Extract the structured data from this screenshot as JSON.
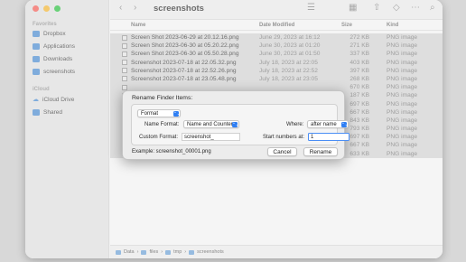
{
  "window": {
    "title": "screenshots",
    "colors": {
      "close": "#ff5f57",
      "minimize": "#febc2e",
      "zoom": "#28c840",
      "folder": "#4a90d9"
    }
  },
  "toolbar": {
    "back_icon": "‹",
    "forward_icon": "›",
    "view_icon": "☰",
    "group_icon": "▦",
    "share_icon": "⇧",
    "tag_icon": "◇",
    "more_icon": "⋯",
    "search_icon": "⌕"
  },
  "sidebar": {
    "favorites_header": "Favorites",
    "favorites": [
      "Dropbox",
      "Applications",
      "Downloads",
      "screenshots"
    ],
    "icloud_header": "iCloud",
    "icloud": [
      "iCloud Drive",
      "Shared"
    ]
  },
  "columns": {
    "name": "Name",
    "date": "Date Modified",
    "size": "Size",
    "kind": "Kind"
  },
  "files": [
    {
      "name": "Screen Shot 2023-06-29 at 20.12.16.png",
      "date": "June 29, 2023 at 16:12",
      "size": "272 KB",
      "kind": "PNG image"
    },
    {
      "name": "Screen Shot 2023-06-30 at 05.20.22.png",
      "date": "June 30, 2023 at 01:20",
      "size": "271 KB",
      "kind": "PNG image"
    },
    {
      "name": "Screen Shot 2023-06-30 at 05.50.28.png",
      "date": "June 30, 2023 at 01:50",
      "size": "337 KB",
      "kind": "PNG image"
    },
    {
      "name": "Screenshot 2023-07-18 at 22.05.32.png",
      "date": "July 18, 2023 at 22:05",
      "size": "403 KB",
      "kind": "PNG image"
    },
    {
      "name": "Screenshot 2023-07-18 at 22.52.26.png",
      "date": "July 18, 2023 at 22:52",
      "size": "397 KB",
      "kind": "PNG image"
    },
    {
      "name": "Screenshot 2023-07-18 at 23.05.48.png",
      "date": "July 18, 2023 at 23:05",
      "size": "268 KB",
      "kind": "PNG image"
    },
    {
      "name": "",
      "date": "",
      "size": "670 KB",
      "kind": "PNG image"
    },
    {
      "name": "",
      "date": "",
      "size": "187 KB",
      "kind": "PNG image"
    },
    {
      "name": "",
      "date": "",
      "size": "697 KB",
      "kind": "PNG image"
    },
    {
      "name": "",
      "date": "",
      "size": "667 KB",
      "kind": "PNG image"
    },
    {
      "name": "",
      "date": "",
      "size": "843 KB",
      "kind": "PNG image"
    },
    {
      "name": "",
      "date": "",
      "size": "793 KB",
      "kind": "PNG image"
    },
    {
      "name": "",
      "date": "",
      "size": "697 KB",
      "kind": "PNG image"
    },
    {
      "name": "",
      "date": "",
      "size": "667 KB",
      "kind": "PNG image"
    },
    {
      "name": "Screenshot 2023-07-27 at 18.06.52.png",
      "date": "July 27, 2023 at 18:06",
      "size": "633 KB",
      "kind": "PNG image"
    }
  ],
  "pathbar": [
    "Data",
    "files",
    "tmp",
    "screenshots"
  ],
  "dialog": {
    "title": "Rename Finder Items:",
    "mode": "Format",
    "name_format_label": "Name Format:",
    "name_format_value": "Name and Counter",
    "where_label": "Where:",
    "where_value": "after name",
    "custom_format_label": "Custom Format:",
    "custom_format_value": "screenshot_",
    "start_label": "Start numbers at:",
    "start_value": "1",
    "example": "Example: screenshot_00001.png",
    "cancel": "Cancel",
    "rename": "Rename",
    "popup_chevron": "⌃⌄"
  }
}
